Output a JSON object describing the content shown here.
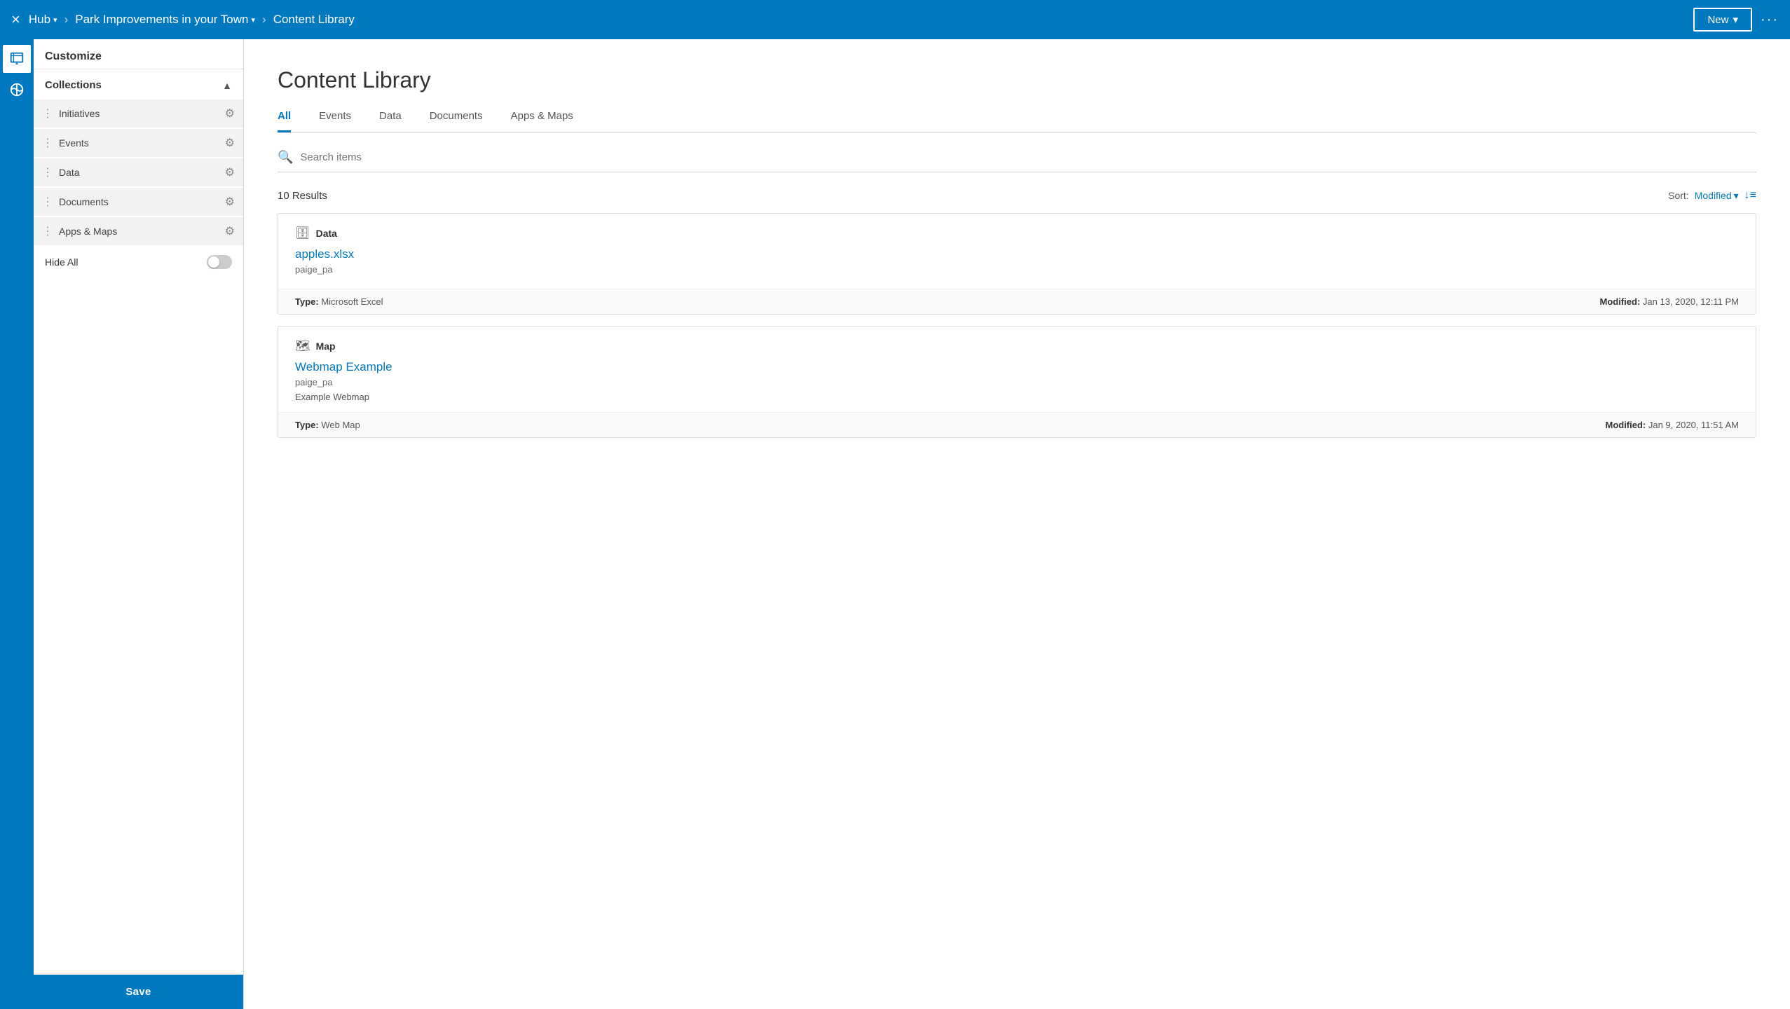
{
  "topnav": {
    "close_label": "×",
    "hub_label": "Hub",
    "breadcrumb_project": "Park Improvements in your Town",
    "breadcrumb_section": "Content Library",
    "new_label": "New",
    "more_label": "···"
  },
  "sidebar": {
    "customize_label": "Customize",
    "collections_label": "Collections",
    "items": [
      {
        "id": "initiatives",
        "label": "Initiatives",
        "draggable": true
      },
      {
        "id": "events",
        "label": "Events",
        "draggable": true
      },
      {
        "id": "data",
        "label": "Data",
        "draggable": true
      },
      {
        "id": "documents",
        "label": "Documents",
        "draggable": true
      },
      {
        "id": "apps-maps",
        "label": "Apps & Maps",
        "draggable": true
      }
    ],
    "hide_all_label": "Hide All",
    "save_label": "Save"
  },
  "main": {
    "title": "Content Library",
    "tabs": [
      {
        "id": "all",
        "label": "All",
        "active": true
      },
      {
        "id": "events",
        "label": "Events",
        "active": false
      },
      {
        "id": "data",
        "label": "Data",
        "active": false
      },
      {
        "id": "documents",
        "label": "Documents",
        "active": false
      },
      {
        "id": "apps-maps",
        "label": "Apps & Maps",
        "active": false
      }
    ],
    "search_placeholder": "Search items",
    "results_count": "10 Results",
    "sort_label": "Sort:",
    "sort_value": "Modified",
    "cards": [
      {
        "type_icon": "database",
        "type_label": "Data",
        "title": "apples.xlsx",
        "owner": "paige_pa",
        "description": "",
        "meta_type_label": "Type:",
        "meta_type_value": "Microsoft Excel",
        "meta_modified_label": "Modified:",
        "meta_modified_value": "Jan 13, 2020, 12:11 PM"
      },
      {
        "type_icon": "map",
        "type_label": "Map",
        "title": "Webmap Example",
        "owner": "paige_pa",
        "description": "Example Webmap",
        "meta_type_label": "Type:",
        "meta_type_value": "Web Map",
        "meta_modified_label": "Modified:",
        "meta_modified_value": "Jan 9, 2020, 11:51 AM"
      }
    ]
  }
}
